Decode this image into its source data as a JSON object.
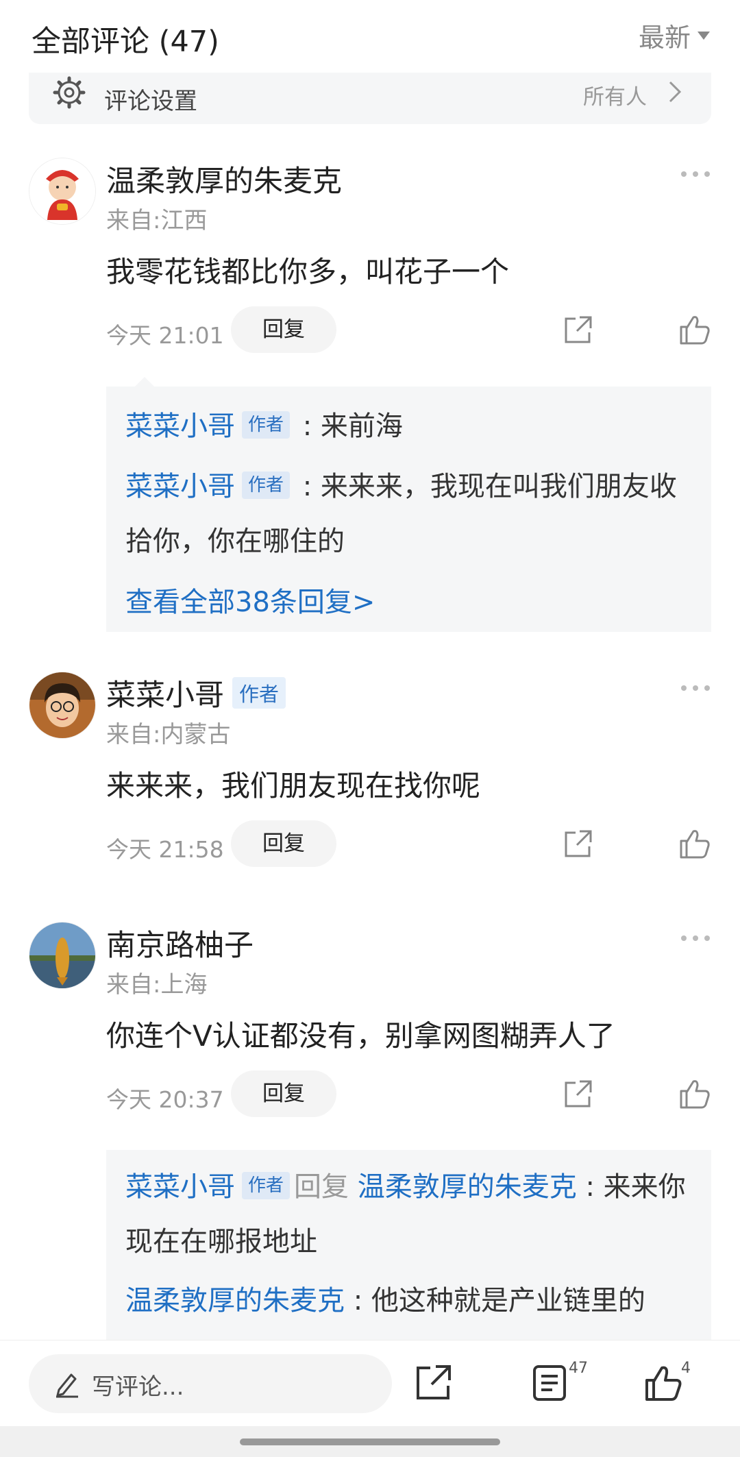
{
  "header": {
    "title": "全部评论 (47)",
    "sort_label": "最新"
  },
  "settings": {
    "label": "评论设置",
    "value": "所有人"
  },
  "reply_button_label": "回复",
  "comments": [
    {
      "name": "温柔敦厚的朱麦克",
      "location": "来自:江西",
      "text": "我零花钱都比你多，叫花子一个",
      "time": "今天 21:01",
      "replies": [
        {
          "name": "菜菜小哥",
          "badge": "作者",
          "text": " : 来前海"
        },
        {
          "name": "菜菜小哥",
          "badge": "作者",
          "text": " : 来来来，我现在叫我们朋友收拾你，你在哪住的"
        }
      ],
      "view_all": "查看全部38条回复>"
    },
    {
      "name": "菜菜小哥",
      "badge": "作者",
      "location": "来自:内蒙古",
      "text": "来来来，我们朋友现在找你呢",
      "time": "今天 21:58"
    },
    {
      "name": "南京路柚子",
      "location": "来自:上海",
      "text": "你连个V认证都没有，别拿网图糊弄人了",
      "time": "今天 20:37",
      "replies": [
        {
          "name": "菜菜小哥",
          "badge": "作者",
          "reply_word": "回复",
          "target": "温柔敦厚的朱麦克",
          "text": " : 来来你现在在哪报地址"
        },
        {
          "name": "温柔敦厚的朱麦克",
          "text": " : 他这种就是产业链里的"
        }
      ]
    }
  ],
  "bottom_bar": {
    "placeholder": "写评论...",
    "comment_count": "47",
    "like_count": "4"
  }
}
